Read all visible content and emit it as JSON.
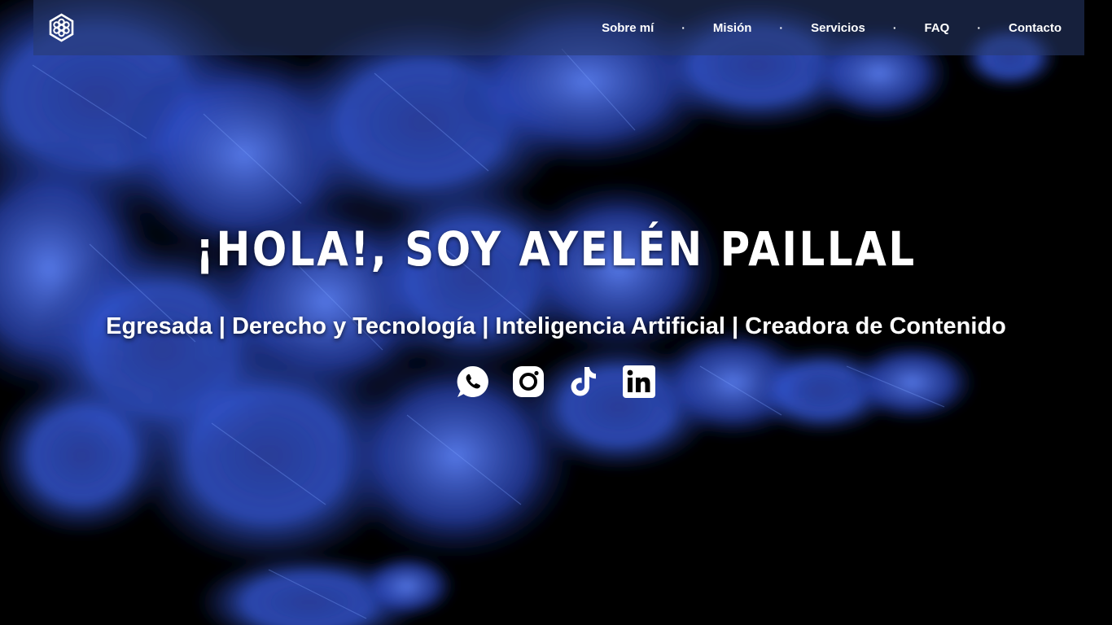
{
  "header": {
    "logo_icon": "hexagon-flower-icon",
    "nav": [
      {
        "label": "Sobre mí"
      },
      {
        "label": "Misión"
      },
      {
        "label": "Servicios"
      },
      {
        "label": "FAQ"
      },
      {
        "label": "Contacto"
      }
    ],
    "separator": "·"
  },
  "hero": {
    "title": "¡HOLA!, SOY AYELÉN PAILLAL",
    "subtitle": "Egresada | Derecho y Tecnología | Inteligencia Artificial | Creadora de Contenido",
    "socials": [
      {
        "icon": "whatsapp-icon"
      },
      {
        "icon": "instagram-icon"
      },
      {
        "icon": "tiktok-icon"
      },
      {
        "icon": "linkedin-icon"
      }
    ]
  },
  "colors": {
    "background": "#000000",
    "accent_blue": "#2f56d6",
    "navbar": "#283a6e",
    "text": "#ffffff"
  }
}
